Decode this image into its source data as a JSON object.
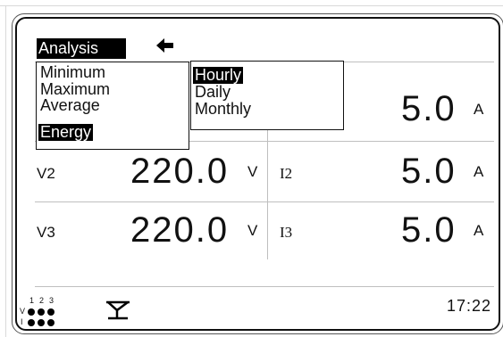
{
  "screen": {
    "title": "Analysis",
    "back_icon": "back-arrow-icon"
  },
  "menu_primary": {
    "items": [
      {
        "label": "Minimum",
        "selected": false
      },
      {
        "label": "Maximum",
        "selected": false
      },
      {
        "label": "Average",
        "selected": false
      },
      {
        "label": "Energy",
        "selected": true
      }
    ]
  },
  "menu_secondary": {
    "items": [
      {
        "label": "Hourly",
        "selected": true
      },
      {
        "label": "Daily",
        "selected": false
      },
      {
        "label": "Monthly",
        "selected": false
      }
    ]
  },
  "readings": {
    "i1_value": "5.0",
    "i1_unit": "A",
    "v2_label": "V2",
    "v2_value": "220.0",
    "v2_unit": "V",
    "i2_label": "I2",
    "i2_value": "5.0",
    "i2_unit": "A",
    "v3_label": "V3",
    "v3_value": "220.0",
    "v3_unit": "V",
    "i3_label": "I3",
    "i3_value": "5.0",
    "i3_unit": "A"
  },
  "status_bar": {
    "phase_numbers": [
      "1",
      "2",
      "3"
    ],
    "row_labels": [
      "V",
      "I"
    ],
    "antenna_icon": "antenna-icon",
    "time": "17:22"
  }
}
